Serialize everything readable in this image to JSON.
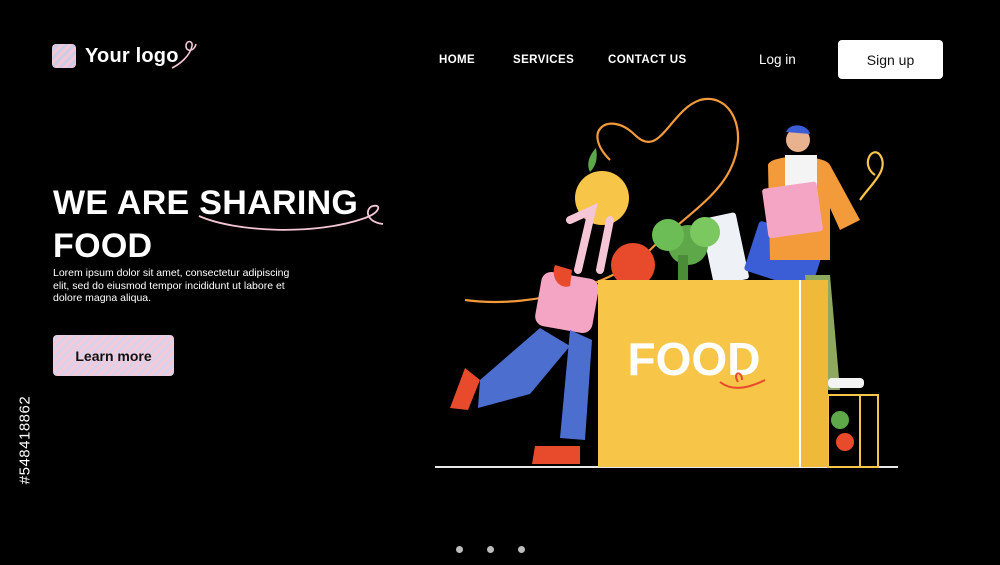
{
  "header": {
    "logo_text": "Your logo",
    "nav": [
      {
        "label": "HOME"
      },
      {
        "label": "SERVICES"
      },
      {
        "label": "CONTACT US"
      }
    ],
    "login_label": "Log in",
    "signup_label": "Sign up"
  },
  "hero": {
    "title_line1": "WE ARE SHARING",
    "title_line2": "FOOD",
    "body": "Lorem ipsum dolor sit amet, consectetur adipiscing elit, sed do eiusmod tempor incididunt ut labore et dolore magna aliqua.",
    "cta_label": "Learn more"
  },
  "illustration": {
    "box_label": "FOOD"
  },
  "watermark": {
    "id_text": "#548418862"
  },
  "carousel": {
    "slide_count": 3
  },
  "colors": {
    "background": "#000000",
    "box_yellow": "#f7c548",
    "accent_orange": "#f39a3b",
    "accent_pink": "#f4c6d6"
  }
}
